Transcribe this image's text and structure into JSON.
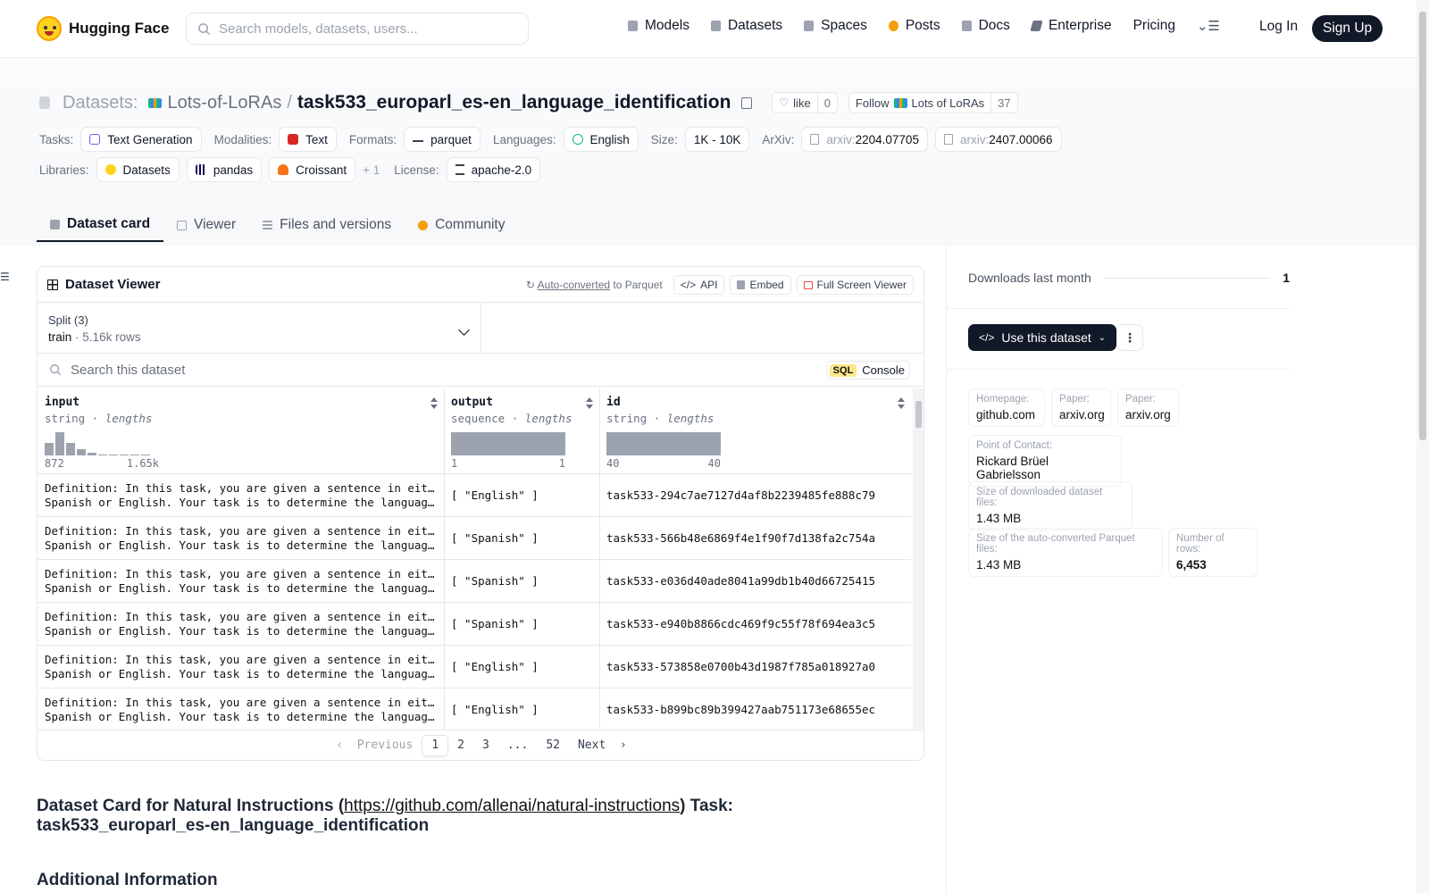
{
  "brand": "Hugging Face",
  "search_placeholder": "Search models, datasets, users...",
  "nav": [
    "Models",
    "Datasets",
    "Spaces",
    "Posts",
    "Docs",
    "Enterprise",
    "Pricing"
  ],
  "login": "Log In",
  "signup": "Sign Up",
  "header": {
    "section": "Datasets:",
    "org": "Lots-of-LoRAs",
    "sep": "/",
    "name": "task533_europarl_es-en_language_identification",
    "like": "like",
    "like_count": "0",
    "follow": "Follow",
    "follow_org": "Lots of LoRAs",
    "follow_count": "37"
  },
  "tags": {
    "tasks_label": "Tasks:",
    "task": "Text Generation",
    "modalities_label": "Modalities:",
    "modality": "Text",
    "formats_label": "Formats:",
    "format": "parquet",
    "languages_label": "Languages:",
    "language": "English",
    "size_label": "Size:",
    "size": "1K - 10K",
    "arxiv_label": "ArXiv:",
    "arxiv_prefix": "arxiv:",
    "arxiv1": "2204.07705",
    "arxiv2": "2407.00066",
    "libraries_label": "Libraries:",
    "lib1": "Datasets",
    "lib2": "pandas",
    "lib3": "Croissant",
    "lib_more": "+ 1",
    "license_label": "License:",
    "license": "apache-2.0"
  },
  "tabs": [
    "Dataset card",
    "Viewer",
    "Files and versions",
    "Community"
  ],
  "viewer": {
    "title": "Dataset Viewer",
    "auto_converted": "Auto-converted",
    "to_parquet": "to Parquet",
    "api": "API",
    "embed": "Embed",
    "fullscreen": "Full Screen Viewer",
    "split_label": "Split (3)",
    "split_name": "train",
    "split_rows": "5.16k rows",
    "search_placeholder": "Search this dataset",
    "sql": "SQL",
    "console": "Console",
    "columns": [
      {
        "name": "input",
        "type": "string",
        "kind": "lengths",
        "min": "872",
        "max": "1.65k"
      },
      {
        "name": "output",
        "type": "sequence",
        "kind": "lengths",
        "min": "1",
        "max": "1"
      },
      {
        "name": "id",
        "type": "string",
        "kind": "lengths",
        "min": "40",
        "max": "40"
      }
    ],
    "rows": [
      {
        "input1": "Definition: In this task, you are given a sentence in either",
        "input2": "Spanish or English. Your task is to determine the language of the input sentence.",
        "output": "[ \"English\" ]",
        "id": "task533-294c7ae7127d4af8b2239485fe888c79"
      },
      {
        "input1": "Definition: In this task, you are given a sentence in either",
        "input2": "Spanish or English. Your task is to determine the language of the input sentence.",
        "output": "[ \"Spanish\" ]",
        "id": "task533-566b48e6869f4e1f90f7d138fa2c754a"
      },
      {
        "input1": "Definition: In this task, you are given a sentence in either",
        "input2": "Spanish or English. Your task is to determine the language of the input sentence.",
        "output": "[ \"Spanish\" ]",
        "id": "task533-e036d40ade8041a99db1b40d66725415"
      },
      {
        "input1": "Definition: In this task, you are given a sentence in either",
        "input2": "Spanish or English. Your task is to determine the language of the input sentence.",
        "output": "[ \"Spanish\" ]",
        "id": "task533-e940b8866cdc469f9c55f78f694ea3c5"
      },
      {
        "input1": "Definition: In this task, you are given a sentence in either",
        "input2": "Spanish or English. Your task is to determine the language of the input sentence.",
        "output": "[ \"English\" ]",
        "id": "task533-573858e0700b43d1987f785a018927a0"
      },
      {
        "input1": "Definition: In this task, you are given a sentence in either",
        "input2": "Spanish or English. Your task is to determine the language of the input sentence.",
        "output": "[ \"English\" ]",
        "id": "task533-b899bc89b399427aab751173e68655ec"
      }
    ],
    "pager": {
      "prev": "Previous",
      "p1": "1",
      "p2": "2",
      "p3": "3",
      "dots": "...",
      "last": "52",
      "next": "Next"
    }
  },
  "input_length_histogram": [
    0.55,
    1.0,
    0.55,
    0.25,
    0.1,
    0.05,
    0.05,
    0.05,
    0.05,
    0.05
  ],
  "card": {
    "title_pre": "Dataset Card for Natural Instructions (",
    "link": "https://github.com/allenai/natural-instructions",
    "title_post": ") Task: task533_europarl_es-en_language_identification",
    "additional": "Additional Information"
  },
  "sidebar": {
    "downloads_label": "Downloads last month",
    "downloads_value": "1",
    "use_dataset": "Use this dataset",
    "homepage_k": "Homepage:",
    "homepage_v": "github.com",
    "paper_k": "Paper:",
    "paper1_v": "arxiv.org",
    "paper2_v": "arxiv.org",
    "contact_k": "Point of Contact:",
    "contact_v": "Rickard Brüel Gabrielsson",
    "dlsize_k": "Size of downloaded dataset files:",
    "dlsize_v": "1.43 MB",
    "pqsize_k": "Size of the auto-converted Parquet files:",
    "pqsize_v": "1.43 MB",
    "nrows_k": "Number of rows:",
    "nrows_v": "6,453"
  }
}
